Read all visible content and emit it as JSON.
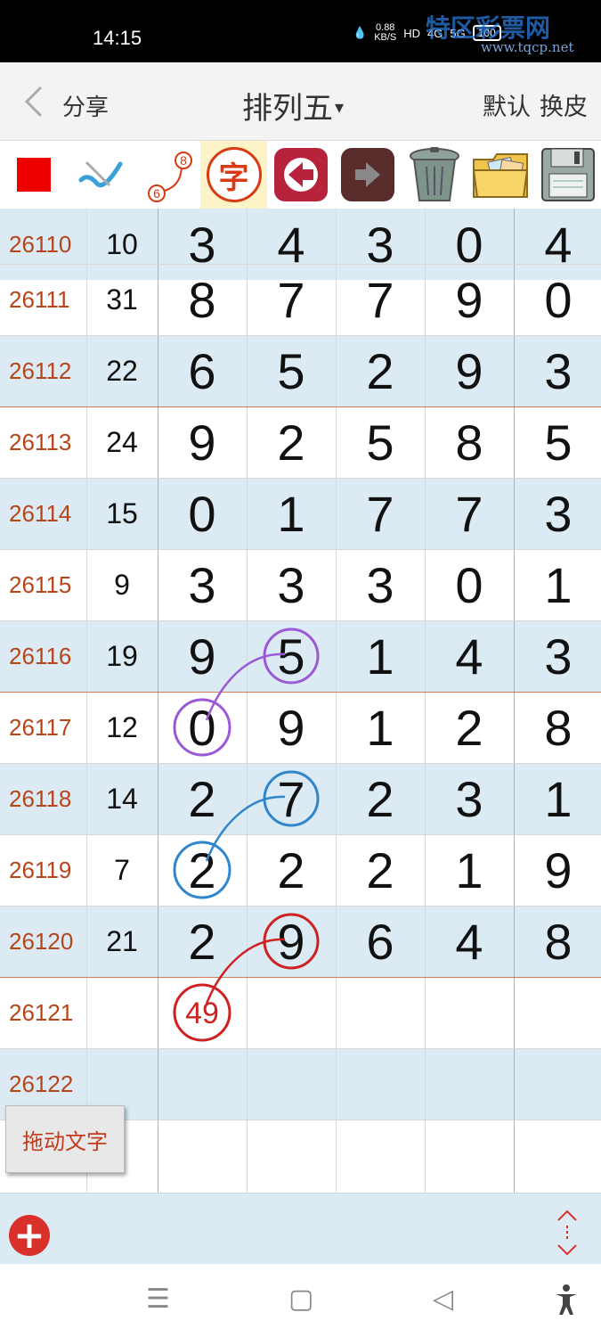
{
  "status": {
    "time": "14:15",
    "net_speed_value": "0.88",
    "net_speed_unit": "KB/S",
    "hd": "HD",
    "four_g": "4G",
    "five_g": "5G",
    "battery": "100",
    "watermark": "特区彩票网",
    "watermark_url": "www.tqcp.net"
  },
  "header": {
    "share": "分享",
    "title": "排列五",
    "caret": "▾",
    "default": "默认",
    "skin": "换皮"
  },
  "toolbar": {
    "zi": "字",
    "badge_top": "8",
    "badge_bottom": "6",
    "colors": {
      "red": "#e00000",
      "zi": "#d83a14"
    }
  },
  "rows": [
    {
      "issue": "26110",
      "sum": "10",
      "d": [
        "3",
        "4",
        "3",
        "0",
        "4"
      ]
    },
    {
      "issue": "26111",
      "sum": "31",
      "d": [
        "8",
        "7",
        "7",
        "9",
        "0"
      ]
    },
    {
      "issue": "26112",
      "sum": "22",
      "d": [
        "6",
        "5",
        "2",
        "9",
        "3"
      ]
    },
    {
      "issue": "26113",
      "sum": "24",
      "d": [
        "9",
        "2",
        "5",
        "8",
        "5"
      ]
    },
    {
      "issue": "26114",
      "sum": "15",
      "d": [
        "0",
        "1",
        "7",
        "7",
        "3"
      ]
    },
    {
      "issue": "26115",
      "sum": "9",
      "d": [
        "3",
        "3",
        "3",
        "0",
        "1"
      ]
    },
    {
      "issue": "26116",
      "sum": "19",
      "d": [
        "9",
        "5",
        "1",
        "4",
        "3"
      ]
    },
    {
      "issue": "26117",
      "sum": "12",
      "d": [
        "0",
        "9",
        "1",
        "2",
        "8"
      ]
    },
    {
      "issue": "26118",
      "sum": "14",
      "d": [
        "2",
        "7",
        "2",
        "3",
        "1"
      ]
    },
    {
      "issue": "26119",
      "sum": "7",
      "d": [
        "2",
        "2",
        "2",
        "1",
        "9"
      ]
    },
    {
      "issue": "26120",
      "sum": "21",
      "d": [
        "2",
        "9",
        "6",
        "4",
        "8"
      ]
    },
    {
      "issue": "26121",
      "sum": "",
      "d": [
        "",
        "",
        "",
        "",
        ""
      ]
    },
    {
      "issue": "26122",
      "sum": "",
      "d": [
        "",
        "",
        "",
        "",
        ""
      ]
    },
    {
      "issue": "",
      "sum": "",
      "d": [
        "",
        "",
        "",
        "",
        ""
      ]
    }
  ],
  "annotation": {
    "text": "49",
    "colors": {
      "purple": "#9b59d6",
      "blue": "#2f86cc",
      "red": "#cc2222"
    }
  },
  "drag_button": "拖动文字",
  "bottom": {
    "plus": "+",
    "updown": "⇕"
  },
  "nav": {
    "menu": "☰",
    "home": "▢",
    "back": "◁"
  }
}
